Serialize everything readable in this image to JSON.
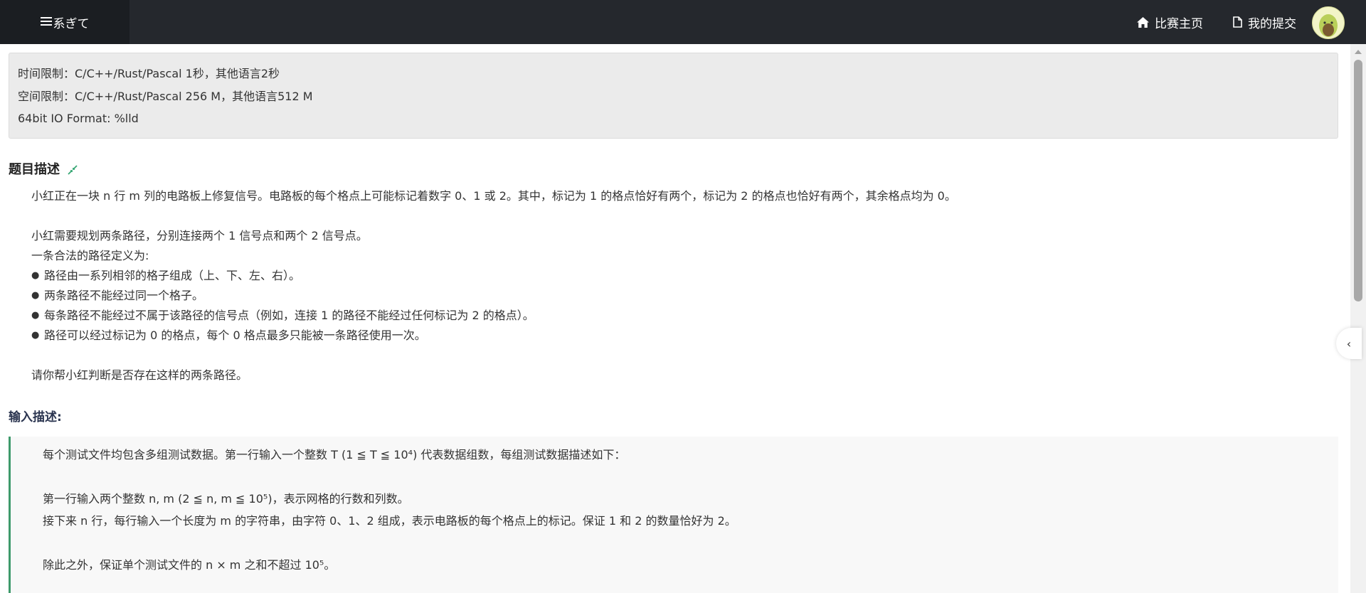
{
  "nav": {
    "menu_label": "系ぎて",
    "home_label": "比赛主页",
    "submissions_label": "我的提交"
  },
  "limits": {
    "time": "时间限制：C/C++/Rust/Pascal 1秒，其他语言2秒",
    "space": "空间限制：C/C++/Rust/Pascal 256 M，其他语言512 M",
    "io": "64bit IO Format: %lld"
  },
  "problem": {
    "title": "题目描述",
    "p1": "小红正在一块 n 行 m 列的电路板上修复信号。电路板的每个格点上可能标记着数字 0、1 或 2。其中，标记为 1 的格点恰好有两个，标记为 2 的格点也恰好有两个，其余格点均为 0。",
    "p2": "小红需要规划两条路径，分别连接两个 1 信号点和两个 2 信号点。",
    "p3": "一条合法的路径定义为:",
    "rules": [
      "路径由一系列相邻的格子组成（上、下、左、右）。",
      "两条路径不能经过同一个格子。",
      "每条路径不能经过不属于该路径的信号点（例如，连接 1 的路径不能经过任何标记为 2 的格点）。",
      "路径可以经过标记为 0 的格点，每个 0 格点最多只能被一条路径使用一次。"
    ],
    "p4": "请你帮小红判断是否存在这样的两条路径。"
  },
  "input": {
    "title": "输入描述:",
    "line1": "每个测试文件均包含多组测试数据。第一行输入一个整数 T (1 ≦ T ≦ 10⁴) 代表数据组数，每组测试数据描述如下：",
    "line2": "第一行输入两个整数 n, m (2 ≦ n, m ≦ 10⁵)，表示网格的行数和列数。",
    "line3": "接下来 n 行，每行输入一个长度为 m 的字符串，由字符 0、1、2 组成，表示电路板的每个格点上的标记。保证 1 和 2 的数量恰好为 2。",
    "line4": "除此之外，保证单个测试文件的 n × m 之和不超过 10⁵。"
  },
  "side_toggle": "‹"
}
